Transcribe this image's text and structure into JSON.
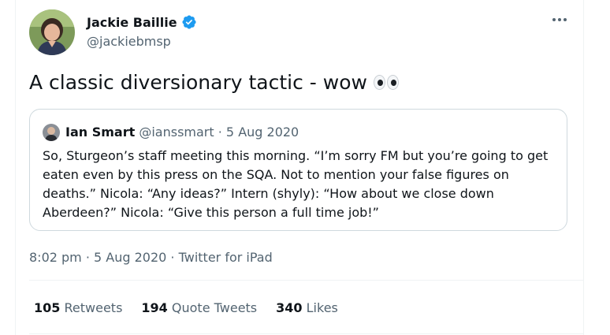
{
  "author": {
    "name": "Jackie Baillie",
    "handle": "@jackiebmsp",
    "verified": true
  },
  "tweet": {
    "text": "A classic diversionary tactic - wow",
    "emoji": "eyes-emoji"
  },
  "quoted_tweet": {
    "name": "Ian Smart",
    "handle": "@ianssmart",
    "separator": " · ",
    "date": "5 Aug 2020",
    "body": "So, Sturgeon’s staff meeting this morning. “I’m sorry FM but you’re going to get eaten even by this press on the SQA. Not to mention your false figures on deaths.” Nicola: “Any ideas?” Intern (shyly): “How about we close down Aberdeen?” Nicola: “Give this person a full time job!”"
  },
  "meta": {
    "time": "8:02 pm",
    "sep1": " · ",
    "date": "5 Aug 2020",
    "sep2": " · ",
    "source": "Twitter for iPad"
  },
  "stats": {
    "retweets_count": "105",
    "retweets_label": "Retweets",
    "quotes_count": "194",
    "quotes_label": "Quote Tweets",
    "likes_count": "340",
    "likes_label": "Likes"
  },
  "colors": {
    "verified_blue": "#1d9bf0",
    "secondary_text": "#536471",
    "primary_text": "#0f1419",
    "border": "#cfd9de"
  }
}
